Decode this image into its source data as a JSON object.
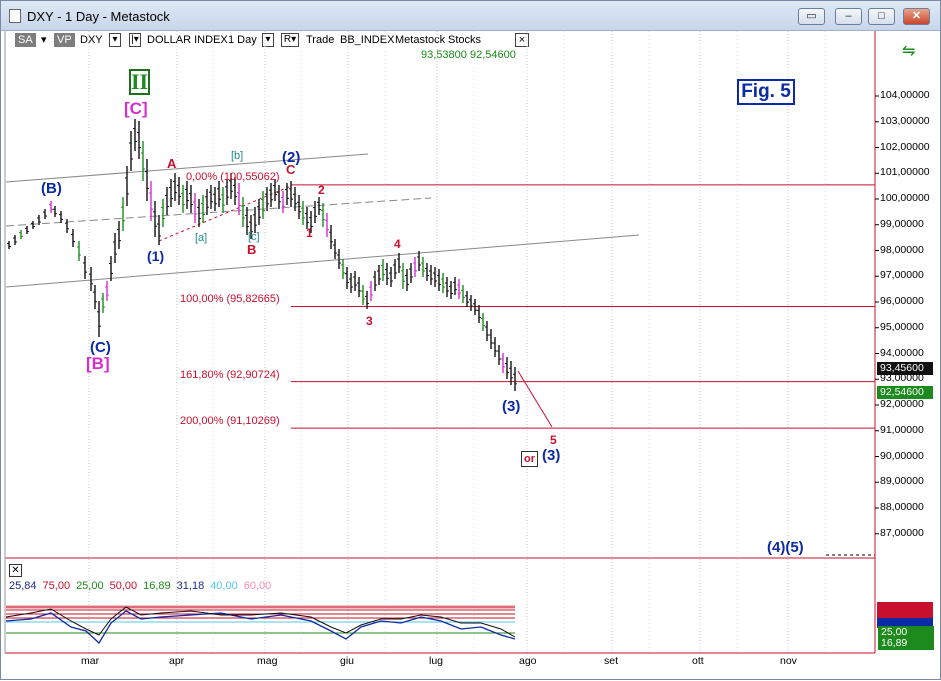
{
  "window": {
    "title": "DXY - 1 Day - Metastock",
    "controls": [
      "restore",
      "minimize",
      "maximize",
      "close"
    ]
  },
  "toolbar": {
    "sa": "SA",
    "vp": "VP",
    "symbol": "DXY",
    "name": "DOLLAR INDEX",
    "period": "1 Day",
    "r_button": "R",
    "mode": "Trade",
    "source": "BB_INDEX",
    "provider": "Metastock",
    "category": "Stocks",
    "close_glyph": "×"
  },
  "readout": {
    "high": "93,53800",
    "low": "92,54600"
  },
  "fig": "Fig. 5",
  "price_axis": [
    "104,00000",
    "103,00000",
    "102,00000",
    "101,00000",
    "100,00000",
    "99,00000",
    "98,00000",
    "97,00000",
    "96,00000",
    "95,00000",
    "94,00000",
    "93,00000",
    "92,00000",
    "91,00000",
    "90,00000",
    "89,00000",
    "88,00000",
    "87,00000"
  ],
  "price_tags": {
    "current": "93,45600",
    "green": "92,54600"
  },
  "months": [
    "mar",
    "apr",
    "mag",
    "giu",
    "lug",
    "ago",
    "set",
    "ott",
    "nov"
  ],
  "levels": [
    {
      "label": "0,00% (100,55062)"
    },
    {
      "label": "100,00% (95,82665)"
    },
    {
      "label": "161,80% (92,90724)"
    },
    {
      "label": "200,00% (91,10269)"
    }
  ],
  "waves": {
    "roman": "II",
    "C_bracket": "[C]",
    "B_paren": "(B)",
    "C_paren": "(C)",
    "B_bracket": "[B]",
    "one_paren": "(1)",
    "two_paren": "(2)",
    "three_paren": "(3)",
    "three_paren_alt": "(3)",
    "four_five": "(4)(5)",
    "A": "A",
    "B": "B",
    "C": "C",
    "a_bracket": "[a]",
    "b_bracket": "[b]",
    "c_bracket": "[c]",
    "n1": "1",
    "n2": "2",
    "n3": "3",
    "n4": "4",
    "n5": "5",
    "or": "or"
  },
  "indicator": {
    "values": [
      {
        "text": "25,84",
        "color": "#1a2a8a"
      },
      {
        "text": "75,00",
        "color": "#c8102e"
      },
      {
        "text": "25,00",
        "color": "#1d8a1d"
      },
      {
        "text": "50,00",
        "color": "#c8102e"
      },
      {
        "text": "16,89",
        "color": "#1d8a1d"
      },
      {
        "text": "31,18",
        "color": "#1a2a8a"
      },
      {
        "text": "40,00",
        "color": "#4fc8e8"
      },
      {
        "text": "60,00",
        "color": "#f58fb0"
      }
    ],
    "tags": [
      "25,00",
      "16,89"
    ]
  },
  "colors": {
    "accent_red": "#c8102e",
    "wave_blue": "#0b2aa6",
    "wave_magenta": "#d62fd0",
    "bar_green": "#1d8a1d",
    "bar_black": "#111111"
  },
  "chart_data": {
    "type": "candlestick",
    "ylim": [
      86.5,
      104.6
    ],
    "levels": [
      100.55062,
      95.82665,
      92.90724,
      91.10269
    ]
  }
}
